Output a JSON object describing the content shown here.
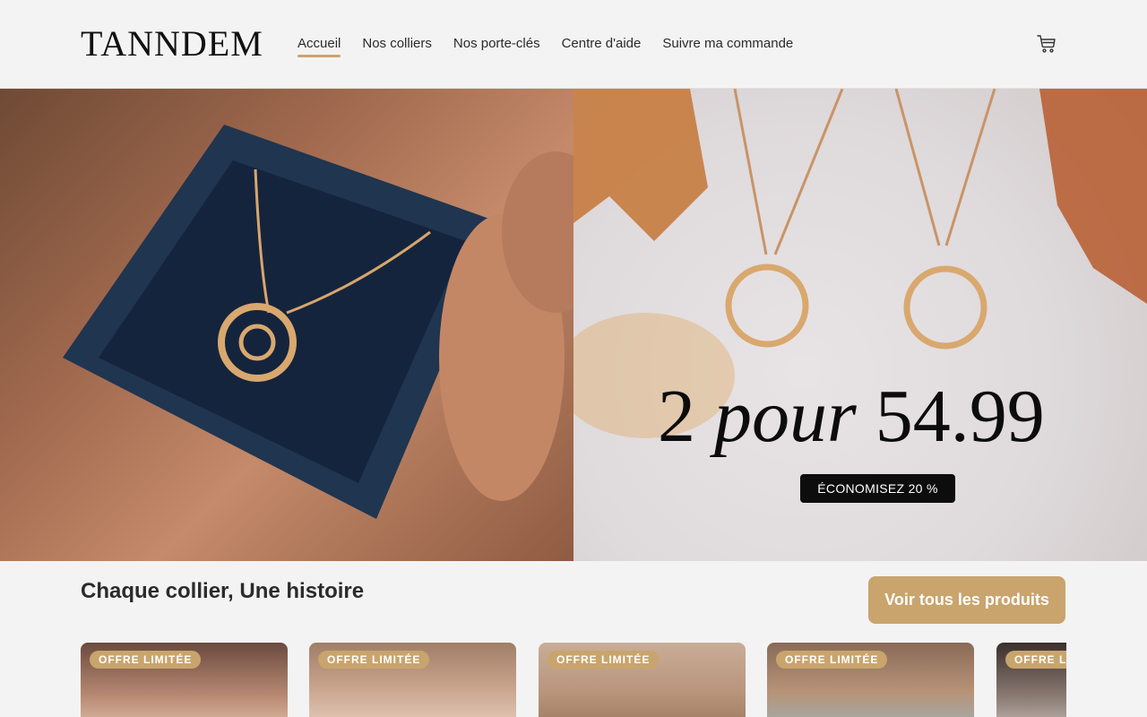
{
  "header": {
    "logo": "TANNDEM",
    "nav": [
      {
        "label": "Accueil",
        "active": true
      },
      {
        "label": "Nos colliers",
        "active": false
      },
      {
        "label": "Nos porte-clés",
        "active": false
      },
      {
        "label": "Centre d'aide",
        "active": false
      },
      {
        "label": "Suivre ma commande",
        "active": false
      }
    ],
    "cart_icon": "cart-icon"
  },
  "hero": {
    "promo_part1": "2 ",
    "promo_part2": "pour",
    "promo_part3": " 54.99",
    "badge": "ÉCONOMISEZ 20 %"
  },
  "section": {
    "title": "Chaque collier, Une histoire",
    "see_all": "Voir tous les produits"
  },
  "products": [
    {
      "badge": "OFFRE LIMITÉE"
    },
    {
      "badge": "OFFRE LIMITÉE"
    },
    {
      "badge": "OFFRE LIMITÉE"
    },
    {
      "badge": "OFFRE LIMITÉE"
    },
    {
      "badge": "OFFRE LIMITÉE"
    }
  ],
  "colors": {
    "accent": "#c9a46d",
    "background": "#f4f3f3",
    "text": "#222222"
  }
}
